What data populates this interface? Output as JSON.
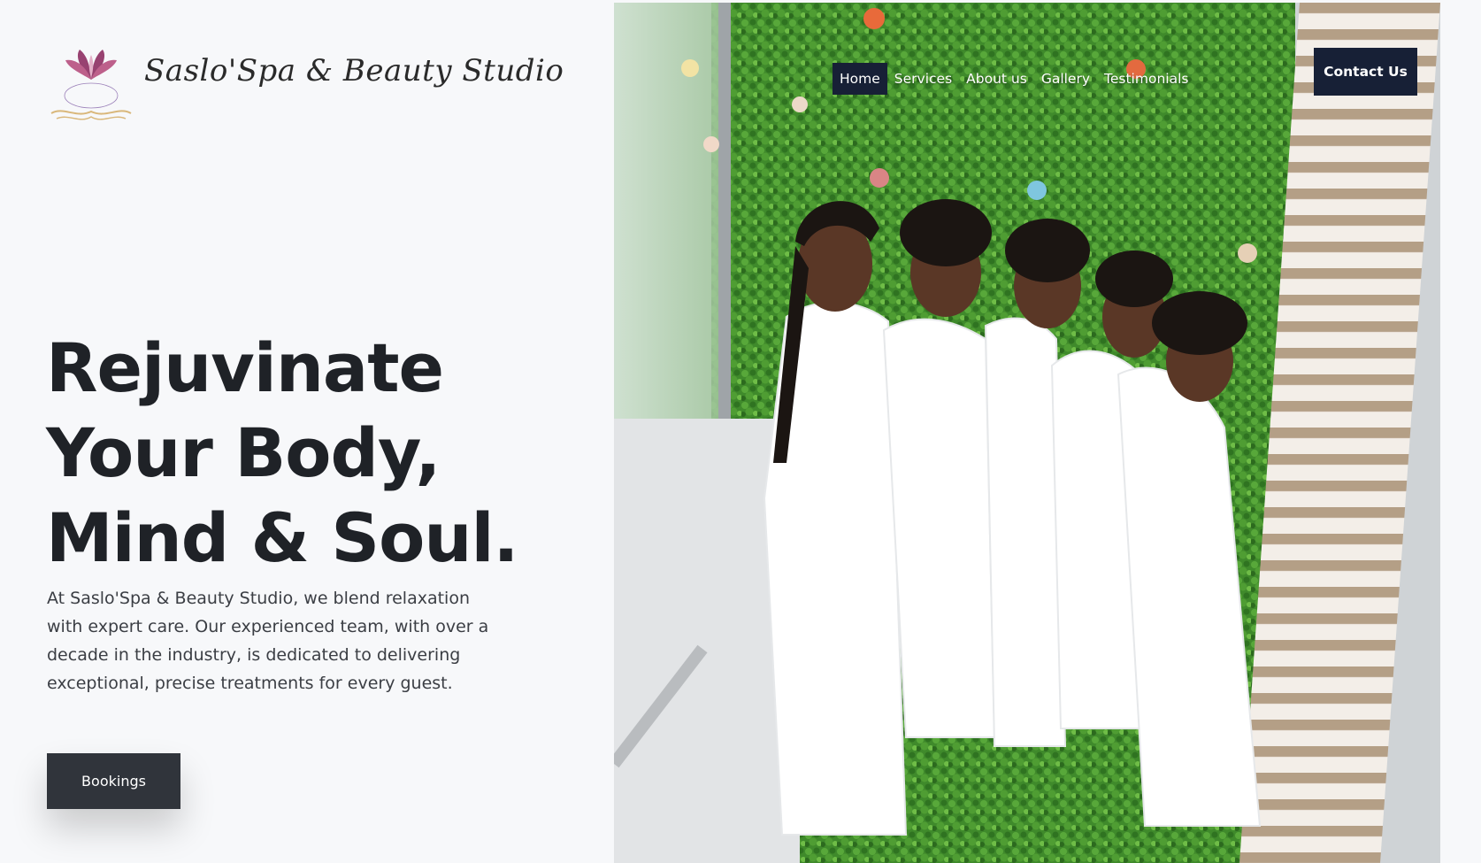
{
  "brand": {
    "name": "Saslo'Spa & Beauty Studio",
    "logo_icon": "lotus-logo-icon"
  },
  "nav": {
    "items": [
      {
        "label": "Home",
        "active": true
      },
      {
        "label": "Services",
        "active": false
      },
      {
        "label": "About us",
        "active": false
      },
      {
        "label": "Gallery",
        "active": false
      },
      {
        "label": "Testimonials",
        "active": false
      }
    ],
    "contact_label": "Contact Us"
  },
  "hero": {
    "headline_lines": [
      "Rejuvinate",
      "Your Body,",
      "Mind & Soul."
    ],
    "intro": "At Saslo'Spa & Beauty Studio, we blend relaxation with expert care. Our experienced team, with over a decade in the industry, is dedicated to delivering exceptional, precise treatments for every guest.",
    "bookings_label": "Bookings"
  },
  "colors": {
    "page_bg": "#f7f8fa",
    "text_dark": "#1f2227",
    "button_dark": "#30343b",
    "nav_active": "#172036",
    "wall_green": "#3e8a2a"
  }
}
